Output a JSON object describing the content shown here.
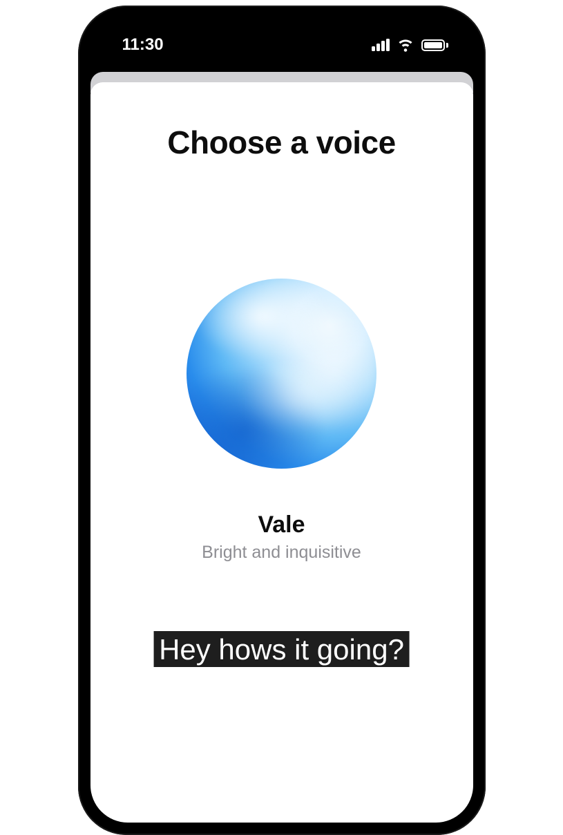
{
  "status": {
    "time": "11:30"
  },
  "sheet": {
    "title": "Choose a voice",
    "voice": {
      "name": "Vale",
      "description": "Bright and inquisitive"
    }
  },
  "caption": {
    "text": "Hey hows it going?"
  }
}
